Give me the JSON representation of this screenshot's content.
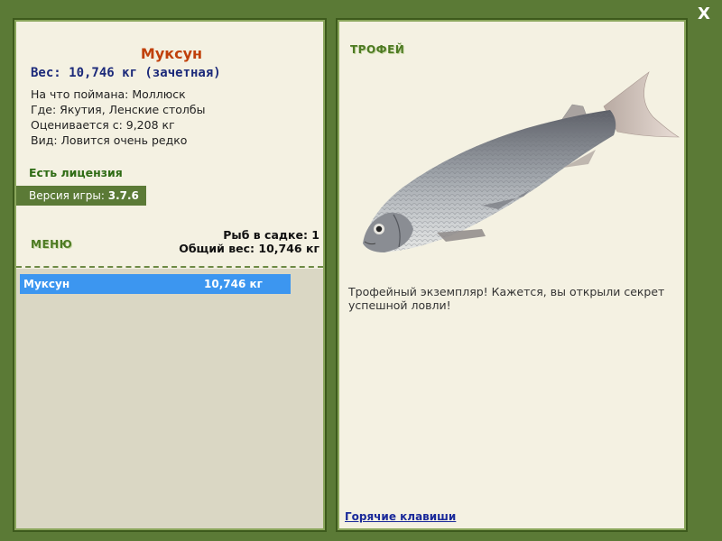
{
  "window": {
    "close_label": "X"
  },
  "fish": {
    "name": "Муксун",
    "weight_line": "Вес: 10,746 кг (зачетная)",
    "bait_line": "На что поймана: Моллюск",
    "location_line": "Где: Якутия, Ленские столбы",
    "value_line": "Оценивается с: 9,208 кг",
    "rarity_line": "Вид: Ловится очень редко"
  },
  "license": {
    "label": "Есть лицензия"
  },
  "version": {
    "label": "Версия игры:",
    "value": "3.7.6"
  },
  "menu": {
    "label": "МЕНЮ"
  },
  "cage": {
    "count_line": "Рыб в садке: 1",
    "total_line": "Общий вес: 10,746 кг"
  },
  "catch_list": [
    {
      "name": "Муксун",
      "weight": "10,746 кг"
    }
  ],
  "trophy": {
    "label": "ТРОФЕЙ",
    "message": "Трофейный экземпляр! Кажется, вы открыли секрет успешной ловли!"
  },
  "hotkeys": {
    "label": "Горячие клавиши"
  },
  "colors": {
    "frame": "#5b7a36",
    "panel": "#f4f1e2",
    "title": "#c0400a",
    "weight": "#1c2a7a",
    "license": "#2e6b14",
    "selection": "#3c96f0"
  }
}
